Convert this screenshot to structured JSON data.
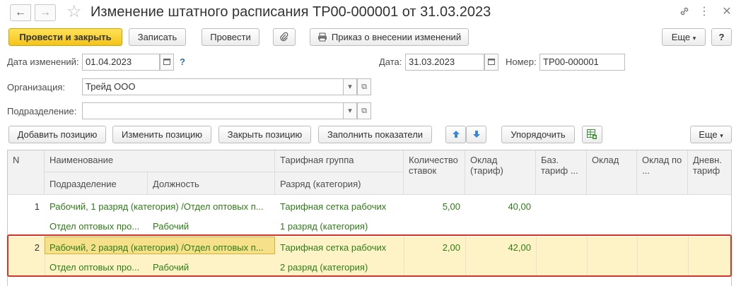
{
  "window": {
    "title": "Изменение штатного расписания ТР00-000001 от 31.03.2023",
    "nav_back": "←",
    "nav_forward": "→",
    "favorite": "☆",
    "link_icon": "🔗",
    "menu_icon": "⋮",
    "close_icon": "✕"
  },
  "toolbar": {
    "post_close": "Провести и закрыть",
    "save": "Записать",
    "post": "Провести",
    "attach_icon": "📎",
    "order": "Приказ о внесении изменений",
    "more": "Еще",
    "more_caret": "▾",
    "help": "?"
  },
  "form": {
    "change_date_label": "Дата изменений:",
    "change_date_value": "01.04.2023",
    "help_mark": "?",
    "date_label": "Дата:",
    "date_value": "31.03.2023",
    "number_label": "Номер:",
    "number_value": "ТР00-000001",
    "org_label": "Организация:",
    "org_value": "Трейд ООО",
    "dept_label": "Подразделение:",
    "dept_value": ""
  },
  "table_toolbar": {
    "add": "Добавить позицию",
    "change": "Изменить позицию",
    "close_pos": "Закрыть позицию",
    "fill": "Заполнить показатели",
    "up_icon": "🡅",
    "down_icon": "🡇",
    "sort": "Упорядочить",
    "more": "Еще",
    "more_caret": "▾"
  },
  "table": {
    "headers": {
      "n": "N",
      "name": "Наименование",
      "dept": "Подразделение",
      "position": "Должность",
      "tariff_group": "Тарифная группа",
      "grade": "Разряд (категория)",
      "rates": "Количество ставок",
      "salary": "Оклад (тариф)",
      "base_tariff": "Баз. тариф ...",
      "salary2": "Оклад",
      "salary_by": "Оклад по ...",
      "daily_tariff": "Дневн. тариф"
    },
    "rows": [
      {
        "n": "1",
        "name": "Рабочий, 1 разряд (категория) /Отдел оптовых п...",
        "dept": "Отдел оптовых про...",
        "position": "Рабочий",
        "tariff_group": "Тарифная сетка рабочих",
        "grade": "1 разряд (категория)",
        "rates": "5,00",
        "salary": "40,00"
      },
      {
        "n": "2",
        "name": "Рабочий, 2 разряд (категория) /Отдел оптовых п...",
        "dept": "Отдел оптовых про...",
        "position": "Рабочий",
        "tariff_group": "Тарифная сетка рабочих",
        "grade": "2 разряд (категория)",
        "rates": "2,00",
        "salary": "42,00"
      }
    ]
  },
  "colors": {
    "selected_row": "#fdf3c7",
    "current_cell": "#f7e08a",
    "highlight_border": "#d5342b",
    "data_text": "#2e7d17",
    "primary_button": "#f4c417"
  }
}
